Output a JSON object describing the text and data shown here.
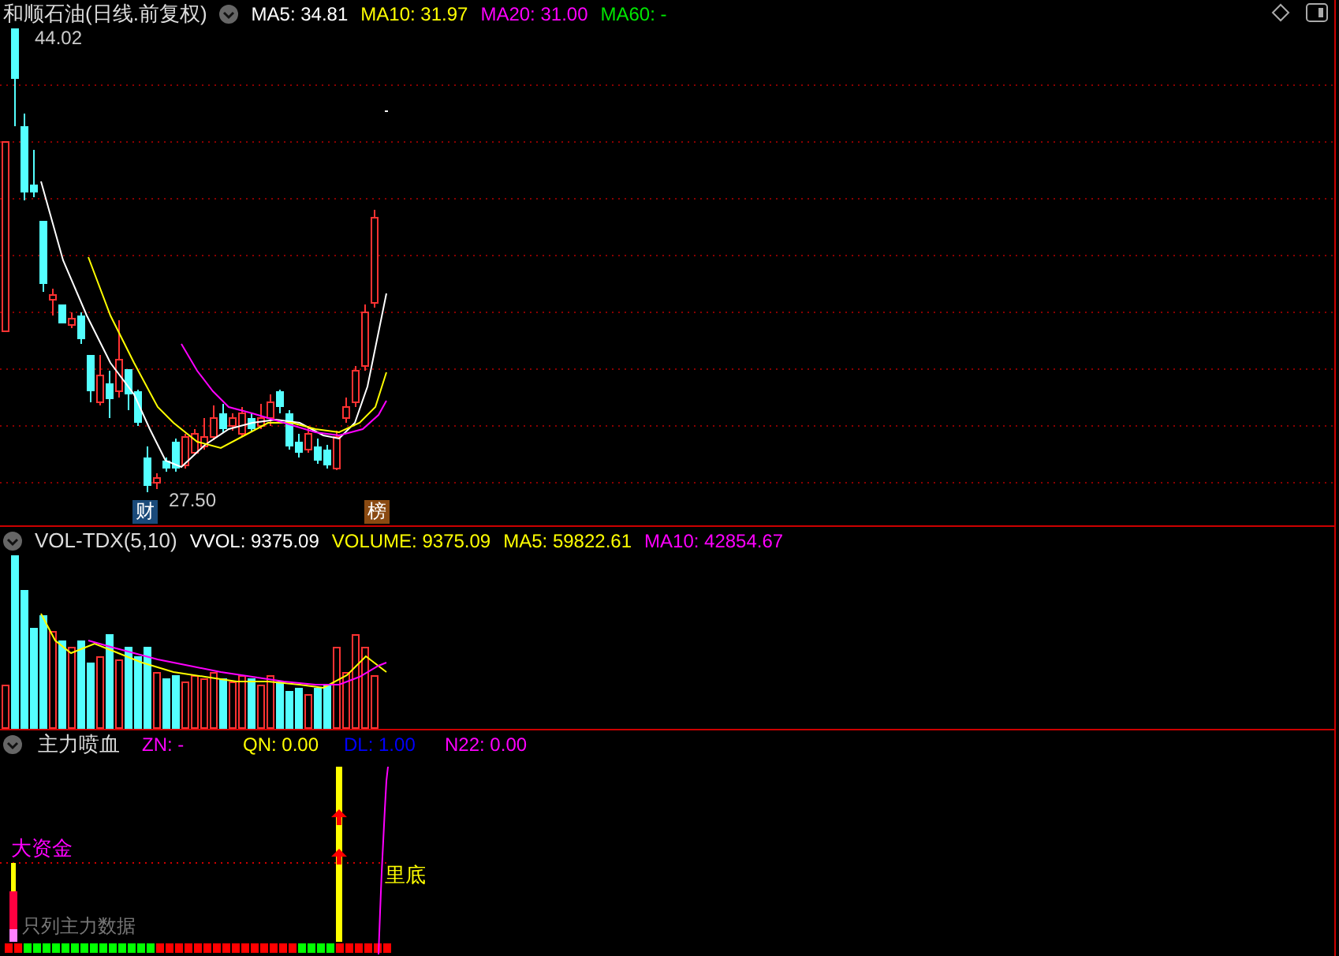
{
  "main_panel": {
    "title": "和顺石油(日线.前复权)",
    "indicators": [
      {
        "label": "MA5: 34.81",
        "color": "#ffffff"
      },
      {
        "label": "MA10: 31.97",
        "color": "#ffff00"
      },
      {
        "label": "MA20: 31.00",
        "color": "#ff00ff"
      },
      {
        "label": "MA60: -",
        "color": "#00e600"
      }
    ],
    "high_label": "44.02",
    "low_label": "27.50",
    "markers": [
      {
        "label": "财",
        "color": "#1a4a7a"
      },
      {
        "label": "榜",
        "color": "#8a4a12"
      }
    ]
  },
  "volume_panel": {
    "title": "VOL-TDX(5,10)",
    "indicators": [
      {
        "label": "VVOL: 9375.09",
        "color": "#ffffff"
      },
      {
        "label": "VOLUME: 9375.09",
        "color": "#ffff00"
      },
      {
        "label": "MA5: 59822.61",
        "color": "#ffff00"
      },
      {
        "label": "MA10: 42854.67",
        "color": "#ff00ff"
      }
    ]
  },
  "indicator_panel": {
    "title": "主力喷血",
    "indicators": [
      {
        "label": "ZN: -",
        "color": "#ff00ff"
      },
      {
        "label": "QN: 0.00",
        "color": "#ffff00"
      },
      {
        "label": "DL: 1.00",
        "color": "#0000ff"
      },
      {
        "label": "N22: 0.00",
        "color": "#ff00ff"
      }
    ],
    "annotations": [
      {
        "label": "大资金",
        "color": "#ff00ff"
      },
      {
        "label": "里底",
        "color": "#ffff00"
      }
    ],
    "note": "只列主力数据"
  }
}
